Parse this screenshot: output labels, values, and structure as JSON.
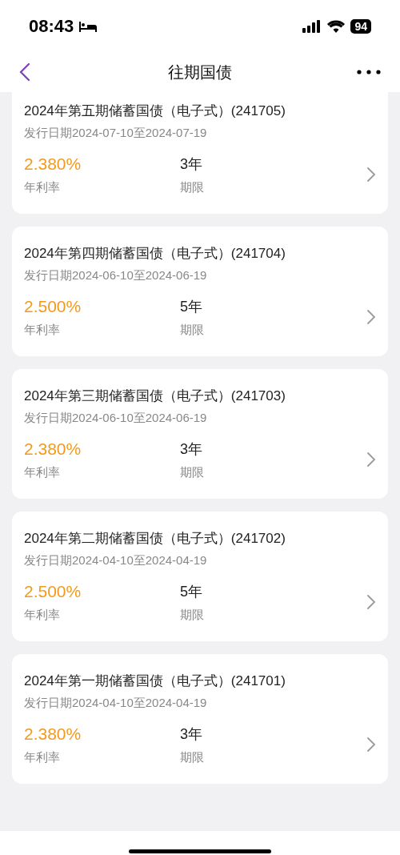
{
  "status_bar": {
    "time": "08:43",
    "battery": "94"
  },
  "header": {
    "title": "往期国债"
  },
  "bonds": [
    {
      "title": "2024年第五期储蓄国债（电子式）(241705)",
      "date": "发行日期2024-07-10至2024-07-19",
      "rate": "2.380%",
      "rate_label": "年利率",
      "term": "3年",
      "term_label": "期限"
    },
    {
      "title": "2024年第四期储蓄国债（电子式）(241704)",
      "date": "发行日期2024-06-10至2024-06-19",
      "rate": "2.500%",
      "rate_label": "年利率",
      "term": "5年",
      "term_label": "期限"
    },
    {
      "title": "2024年第三期储蓄国债（电子式）(241703)",
      "date": "发行日期2024-06-10至2024-06-19",
      "rate": "2.380%",
      "rate_label": "年利率",
      "term": "3年",
      "term_label": "期限"
    },
    {
      "title": "2024年第二期储蓄国债（电子式）(241702)",
      "date": "发行日期2024-04-10至2024-04-19",
      "rate": "2.500%",
      "rate_label": "年利率",
      "term": "5年",
      "term_label": "期限"
    },
    {
      "title": "2024年第一期储蓄国债（电子式）(241701)",
      "date": "发行日期2024-04-10至2024-04-19",
      "rate": "2.380%",
      "rate_label": "年利率",
      "term": "3年",
      "term_label": "期限"
    }
  ]
}
